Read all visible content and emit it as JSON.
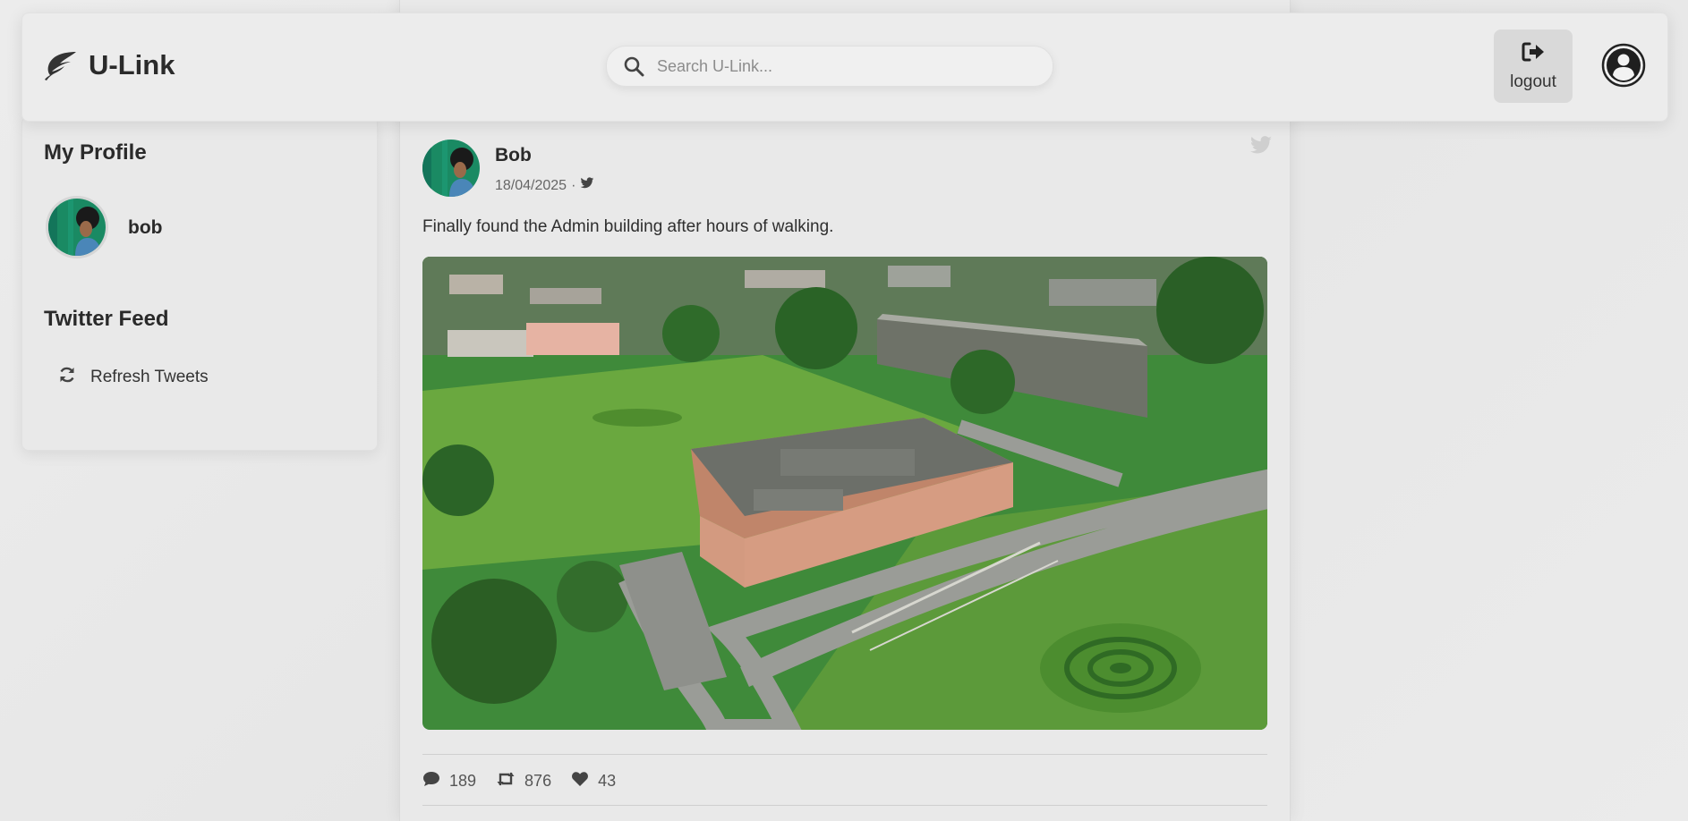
{
  "header": {
    "logo_text": "U-Link",
    "search_placeholder": "Search U-Link...",
    "logout_label": "logout"
  },
  "sidebar": {
    "profile_title": "My Profile",
    "profile_name": "bob",
    "twitter_title": "Twitter Feed",
    "refresh_label": "Refresh Tweets"
  },
  "post": {
    "author": "Bob",
    "date": "18/04/2025",
    "separator": "·",
    "text": "Finally found the Admin building after hours of walking.",
    "stats": {
      "comments": "189",
      "retweets": "876",
      "likes": "43"
    }
  },
  "icons": {
    "logo": "leaf-icon",
    "search": "search-icon",
    "logout": "sign-out-icon",
    "account": "user-circle-icon",
    "refresh": "refresh-icon",
    "source": "twitter-icon",
    "comment": "comment-icon",
    "retweet": "retweet-icon",
    "like": "heart-icon"
  },
  "colors": {
    "background": "#e8e8e8",
    "text": "#2b2b2b",
    "muted": "#666666",
    "logout_bg": "#d9d9d9"
  }
}
